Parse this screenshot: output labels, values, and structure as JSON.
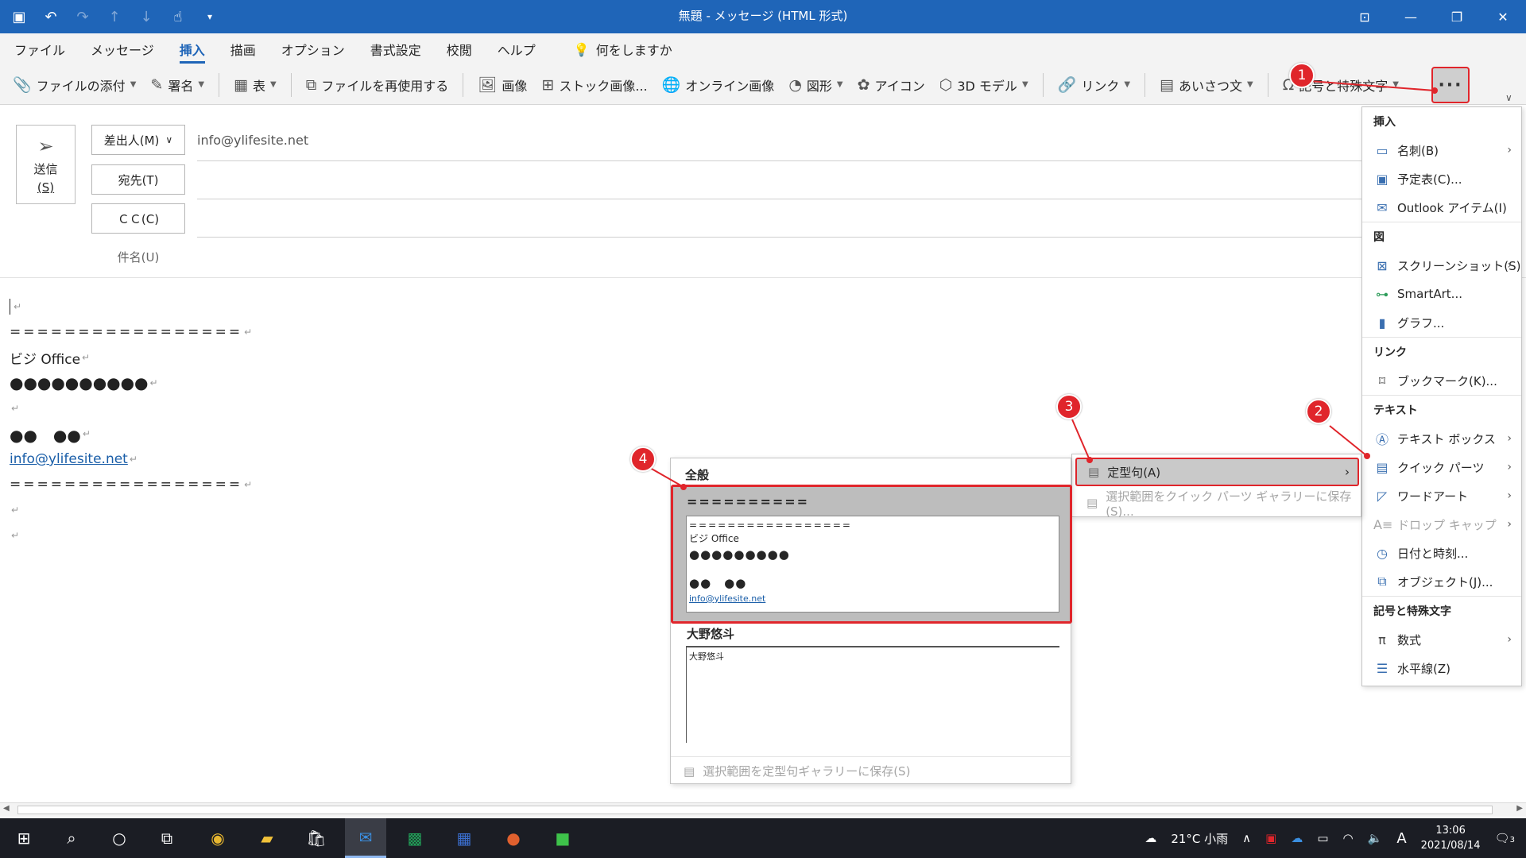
{
  "window": {
    "title": "無題 - メッセージ (HTML 形式)",
    "qat_icons": [
      "save-icon",
      "undo-icon",
      "redo-icon",
      "up-icon",
      "down-icon",
      "touch-icon",
      "customize-icon"
    ],
    "controls": [
      "restore-ribbon-icon",
      "minimize-icon",
      "maximize-icon",
      "close-icon"
    ]
  },
  "menu": {
    "tabs": [
      "ファイル",
      "メッセージ",
      "挿入",
      "描画",
      "オプション",
      "書式設定",
      "校閲",
      "ヘルプ"
    ],
    "active_tab": "挿入",
    "tell_me": "何をしますか"
  },
  "ribbon": {
    "attach": "ファイルの添付",
    "signature": "署名",
    "table": "表",
    "reuse": "ファイルを再使用する",
    "picture": "画像",
    "stock": "ストック画像...",
    "online": "オンライン画像",
    "shapes": "図形",
    "icons": "アイコン",
    "model3d": "3D モデル",
    "link": "リンク",
    "greeting": "あいさつ文",
    "symbols": "記号と特殊文字",
    "more": "···"
  },
  "compose": {
    "send_label": "送信",
    "send_key": "(S)",
    "from_label": "差出人(M)",
    "from_value": "info@ylifesite.net",
    "to_label": "宛先(T)",
    "cc_label": "ＣＣ(C)",
    "subject_label": "件名(U)"
  },
  "body": {
    "lines": [
      "",
      "=================",
      "ビジ Office",
      "●●●●●●●●●●",
      "",
      "●●　●●",
      "info@ylifesite.net",
      "=================",
      "",
      ""
    ],
    "para_mark": "↵"
  },
  "dropdown": {
    "sections": [
      {
        "header": "挿入",
        "items": [
          {
            "label": "名刺(B)",
            "icon": "business-card-icon",
            "arrow": true
          },
          {
            "label": "予定表(C)...",
            "icon": "calendar-icon",
            "arrow": false
          },
          {
            "label": "Outlook アイテム(I)",
            "icon": "outlook-item-icon",
            "arrow": false
          }
        ]
      },
      {
        "header": "図",
        "items": [
          {
            "label": "スクリーンショット(S)",
            "icon": "screenshot-icon",
            "arrow": true
          },
          {
            "label": "SmartArt...",
            "icon": "smartart-icon",
            "arrow": false
          },
          {
            "label": "グラフ...",
            "icon": "chart-icon",
            "arrow": false
          }
        ]
      },
      {
        "header": "リンク",
        "items": [
          {
            "label": "ブックマーク(K)...",
            "icon": "bookmark-icon",
            "arrow": false
          }
        ]
      },
      {
        "header": "テキスト",
        "items": [
          {
            "label": "テキスト ボックス",
            "icon": "text-box-icon",
            "arrow": true
          },
          {
            "label": "クイック パーツ",
            "icon": "quick-parts-icon",
            "arrow": true
          },
          {
            "label": "ワードアート",
            "icon": "wordart-icon",
            "arrow": true
          },
          {
            "label": "ドロップ キャップ",
            "icon": "drop-cap-icon",
            "arrow": true,
            "disabled": true
          },
          {
            "label": "日付と時刻...",
            "icon": "date-time-icon",
            "arrow": false
          },
          {
            "label": "オブジェクト(J)...",
            "icon": "object-icon",
            "arrow": false
          }
        ]
      },
      {
        "header": "記号と特殊文字",
        "items": [
          {
            "label": "数式",
            "icon": "equation-icon",
            "arrow": true
          },
          {
            "label": "水平線(Z)",
            "icon": "horizontal-line-icon",
            "arrow": false
          }
        ]
      }
    ]
  },
  "quickparts_submenu": {
    "autotext": "定型句(A)",
    "save_selection": "選択範囲をクイック パーツ ギャラリーに保存(S)..."
  },
  "gallery": {
    "header": "全般",
    "entry1_title": "==========",
    "entry1_preview": [
      "=================",
      "ビジ Office",
      "●●●●●●●●●",
      "",
      "●●　●●",
      "info@ylifesite.net"
    ],
    "entry2_name": "大野悠斗",
    "entry2_preview": "大野悠斗",
    "footer": "選択範囲を定型句ギャラリーに保存(S)"
  },
  "callouts": [
    "1",
    "2",
    "3",
    "4"
  ],
  "taskbar": {
    "apps": [
      "windows-start-icon",
      "search-icon",
      "cortana-icon",
      "task-view-icon",
      "chrome-icon",
      "explorer-icon",
      "store-icon",
      "outlook-icon",
      "excel-icon",
      "word-icon",
      "powerpoint-icon",
      "line-icon"
    ],
    "weather": "21°C 小雨",
    "ime": "A",
    "time": "13:06",
    "date": "2021/08/14",
    "notifications": "3"
  },
  "colors": {
    "title_bar": "#1f65b8",
    "highlight": "#e0252b",
    "taskbar": "#1b1d24"
  }
}
